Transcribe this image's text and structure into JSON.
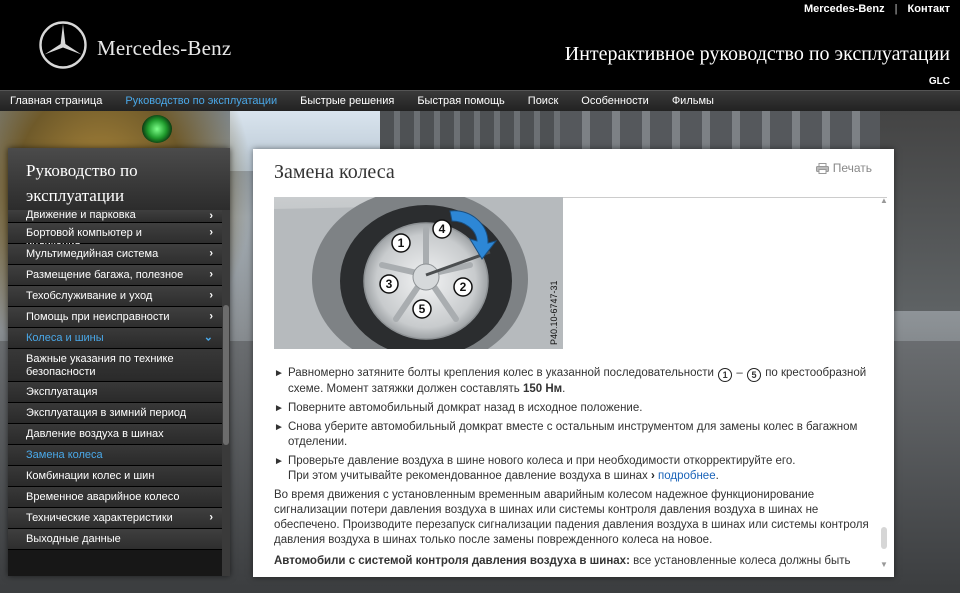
{
  "header": {
    "brand": "Mercedes-Benz",
    "top_links": [
      "Mercedes-Benz",
      "Контакт"
    ],
    "separator": "|",
    "guide_title": "Интерактивное руководство по эксплуатации",
    "model": "GLC"
  },
  "nav": {
    "items": [
      "Главная страница",
      "Руководство по эксплуатации",
      "Быстрые решения",
      "Быстрая помощь",
      "Поиск",
      "Особенности",
      "Фильмы"
    ],
    "active_index": 1,
    "active_color": "#4aa8e8"
  },
  "sidebar": {
    "title_line1": "Руководство по",
    "title_line2": "эксплуатации",
    "items": [
      {
        "label": "Движение и парковка"
      },
      {
        "label": "Бортовой компьютер и индикация"
      },
      {
        "label": "Мультимедийная система"
      },
      {
        "label": "Размещение багажа, полезное"
      },
      {
        "label": "Техобслуживание и уход"
      },
      {
        "label": "Помощь при неисправности"
      },
      {
        "label": "Колеса и шины"
      },
      {
        "label": "Важные указания по технике безопасности"
      },
      {
        "label": "Эксплуатация"
      },
      {
        "label": "Эксплуатация в зимний период"
      },
      {
        "label": "Давление воздуха в шинах"
      },
      {
        "label": "Замена колеса"
      },
      {
        "label": "Комбинации колес и шин"
      },
      {
        "label": "Временное аварийное колесо"
      },
      {
        "label": "Технические характеристики"
      },
      {
        "label": "Выходные данные"
      }
    ]
  },
  "content": {
    "title": "Замена колеса",
    "print_label": "Печать",
    "figure": {
      "code": "P40.10-6747-31",
      "callouts": [
        "1",
        "2",
        "3",
        "4",
        "5"
      ]
    },
    "steps": {
      "s1_a": "Равномерно затяните болты крепления колес в указанной последовательности",
      "s1_from": "1",
      "s1_dash": "–",
      "s1_to": "5",
      "s1_b": "по крестообразной схеме. Момент затяжки должен составлять",
      "s1_torque": "150 Нм",
      "s1_end": ".",
      "s2": "Поверните автомобильный домкрат назад в исходное положение.",
      "s3": "Снова уберите автомобильный домкрат вместе с остальным инструментом для замены колес в багажном отделении.",
      "s4_a": "Проверьте давление воздуха в шине нового колеса и при необходимости откорректируйте его.",
      "s4_b": "При этом учитывайте рекомендованное давление воздуха в шинах",
      "s4_link": "подробнее",
      "s4_end": "."
    },
    "paragraph": "Во время движения с установленным временным аварийным колесом надежное функционирование сигнализации потери давления воздуха в шинах или системы контроля давления воздуха в шинах не обеспечено. Производите перезапуск сигнализации падения давления воздуха в шинах или системы контроля давления воздуха в шинах только после замены поврежденного колеса на новое.",
    "bold_lead": "Автомобили с системой контроля давления воздуха в шинах:",
    "bold_rest": "все установленные колеса должны быть"
  }
}
